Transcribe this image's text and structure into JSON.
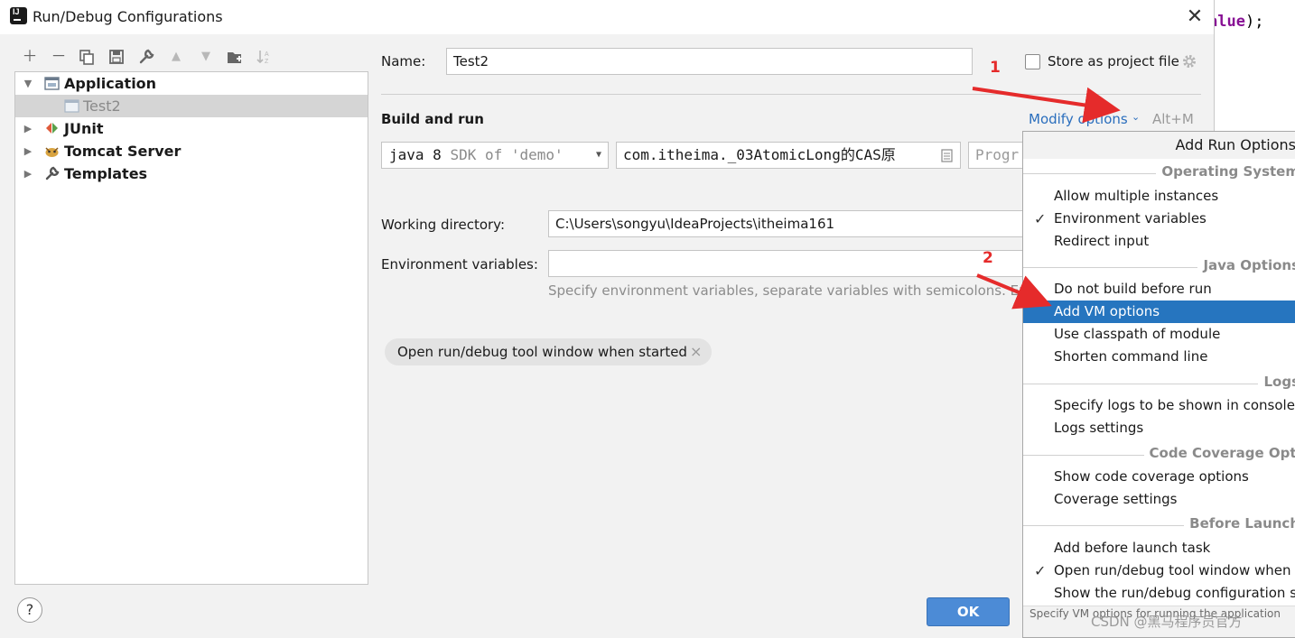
{
  "window": {
    "title": "Run/Debug Configurations"
  },
  "editor": {
    "code_tail": "alue",
    "code_end": ");"
  },
  "tree": {
    "items": [
      {
        "label": "Application"
      },
      {
        "label": "Test2"
      },
      {
        "label": "JUnit"
      },
      {
        "label": "Tomcat Server"
      },
      {
        "label": "Templates"
      }
    ]
  },
  "form": {
    "name_label": "Name:",
    "name_value": "Test2",
    "store_label": "Store as project file",
    "section_title": "Build and run",
    "modify_options": "Modify options",
    "modify_shortcut": "Alt+M",
    "jdk": {
      "name": "java 8",
      "suffix": "SDK of 'demo'"
    },
    "main_class": "com.itheima._03AtomicLong的CAS原",
    "program_args_placeholder": "Progr",
    "workdir_label": "Working directory:",
    "workdir_value": "C:\\Users\\songyu\\IdeaProjects\\itheima161",
    "env_label": "Environment variables:",
    "env_value": "",
    "env_hint": "Specify environment variables, separate variables with semicolons. Exam",
    "chip_label": "Open run/debug tool window when started",
    "chip_close": "×",
    "ok_label": "OK",
    "help_label": "?"
  },
  "popup": {
    "title": "Add Run Options",
    "sections": {
      "os": "Operating System",
      "java": "Java Options",
      "logs": "Logs",
      "coverage": "Code Coverage Optio",
      "before": "Before Launch"
    },
    "items": {
      "allow_multiple": "Allow multiple instances",
      "env_vars": "Environment variables",
      "redirect_input": "Redirect input",
      "no_build": "Do not build before run",
      "add_vm": "Add VM options",
      "use_classpath": "Use classpath of module",
      "shorten_cmd": "Shorten command line",
      "logs_console": "Specify logs to be shown in console",
      "logs_settings": "Logs settings",
      "show_coverage": "Show code coverage options",
      "coverage_settings": "Coverage settings",
      "add_before": "Add before launch task",
      "open_tool_window": "Open run/debug tool window when s",
      "show_settings": "Show the run/debug configuration se"
    },
    "check_glyph": "✓",
    "footer": "Specify VM options for running the application"
  },
  "annotations": {
    "one": "1",
    "two": "2"
  },
  "watermark": "CSDN @黑马程序员官方",
  "colors": {
    "selection": "#2675bf",
    "ok_button": "#4c8bd6",
    "link": "#2a6ebd",
    "annotation": "#e52b2b"
  }
}
